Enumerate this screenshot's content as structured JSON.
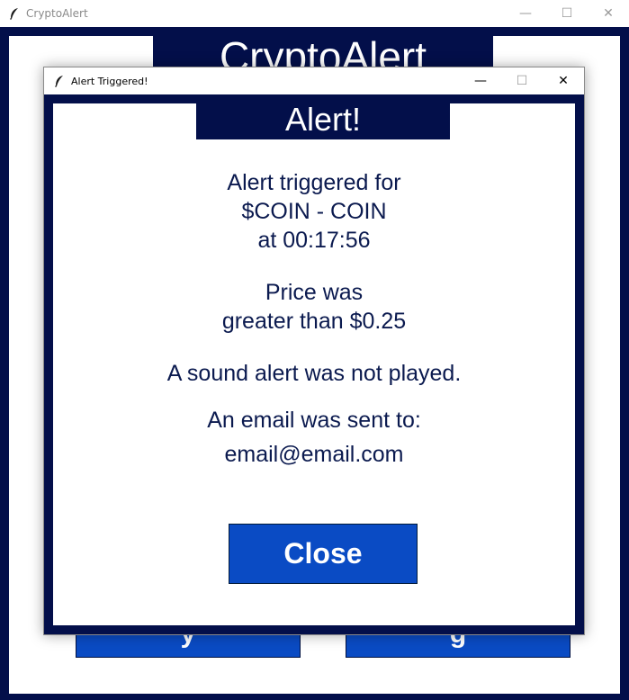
{
  "main_window": {
    "title": "CryptoAlert",
    "controls": {
      "minimize": "—",
      "maximize": "☐",
      "close": "✕"
    },
    "app_heading": "CryptoAlert",
    "background_buttons": [
      {
        "label": "y"
      },
      {
        "label": "g"
      }
    ]
  },
  "dialog": {
    "title": "Alert Triggered!",
    "controls": {
      "minimize": "—",
      "maximize": "☐",
      "close": "✕"
    },
    "header": "Alert!",
    "trigger_lines": [
      "Alert triggered for",
      "$COIN - COIN",
      "at 00:17:56"
    ],
    "price_lines": [
      "Price was",
      "greater than $0.25"
    ],
    "sound_text": "A sound alert was not played.",
    "email_label": "An email was sent to:",
    "email_address": "email@email.com",
    "close_button": "Close"
  },
  "colors": {
    "navy": "#030f4a",
    "button_blue": "#0a4bc4",
    "text_navy": "#0b1a4f"
  },
  "icons": {
    "app_icon": "feather-icon"
  }
}
